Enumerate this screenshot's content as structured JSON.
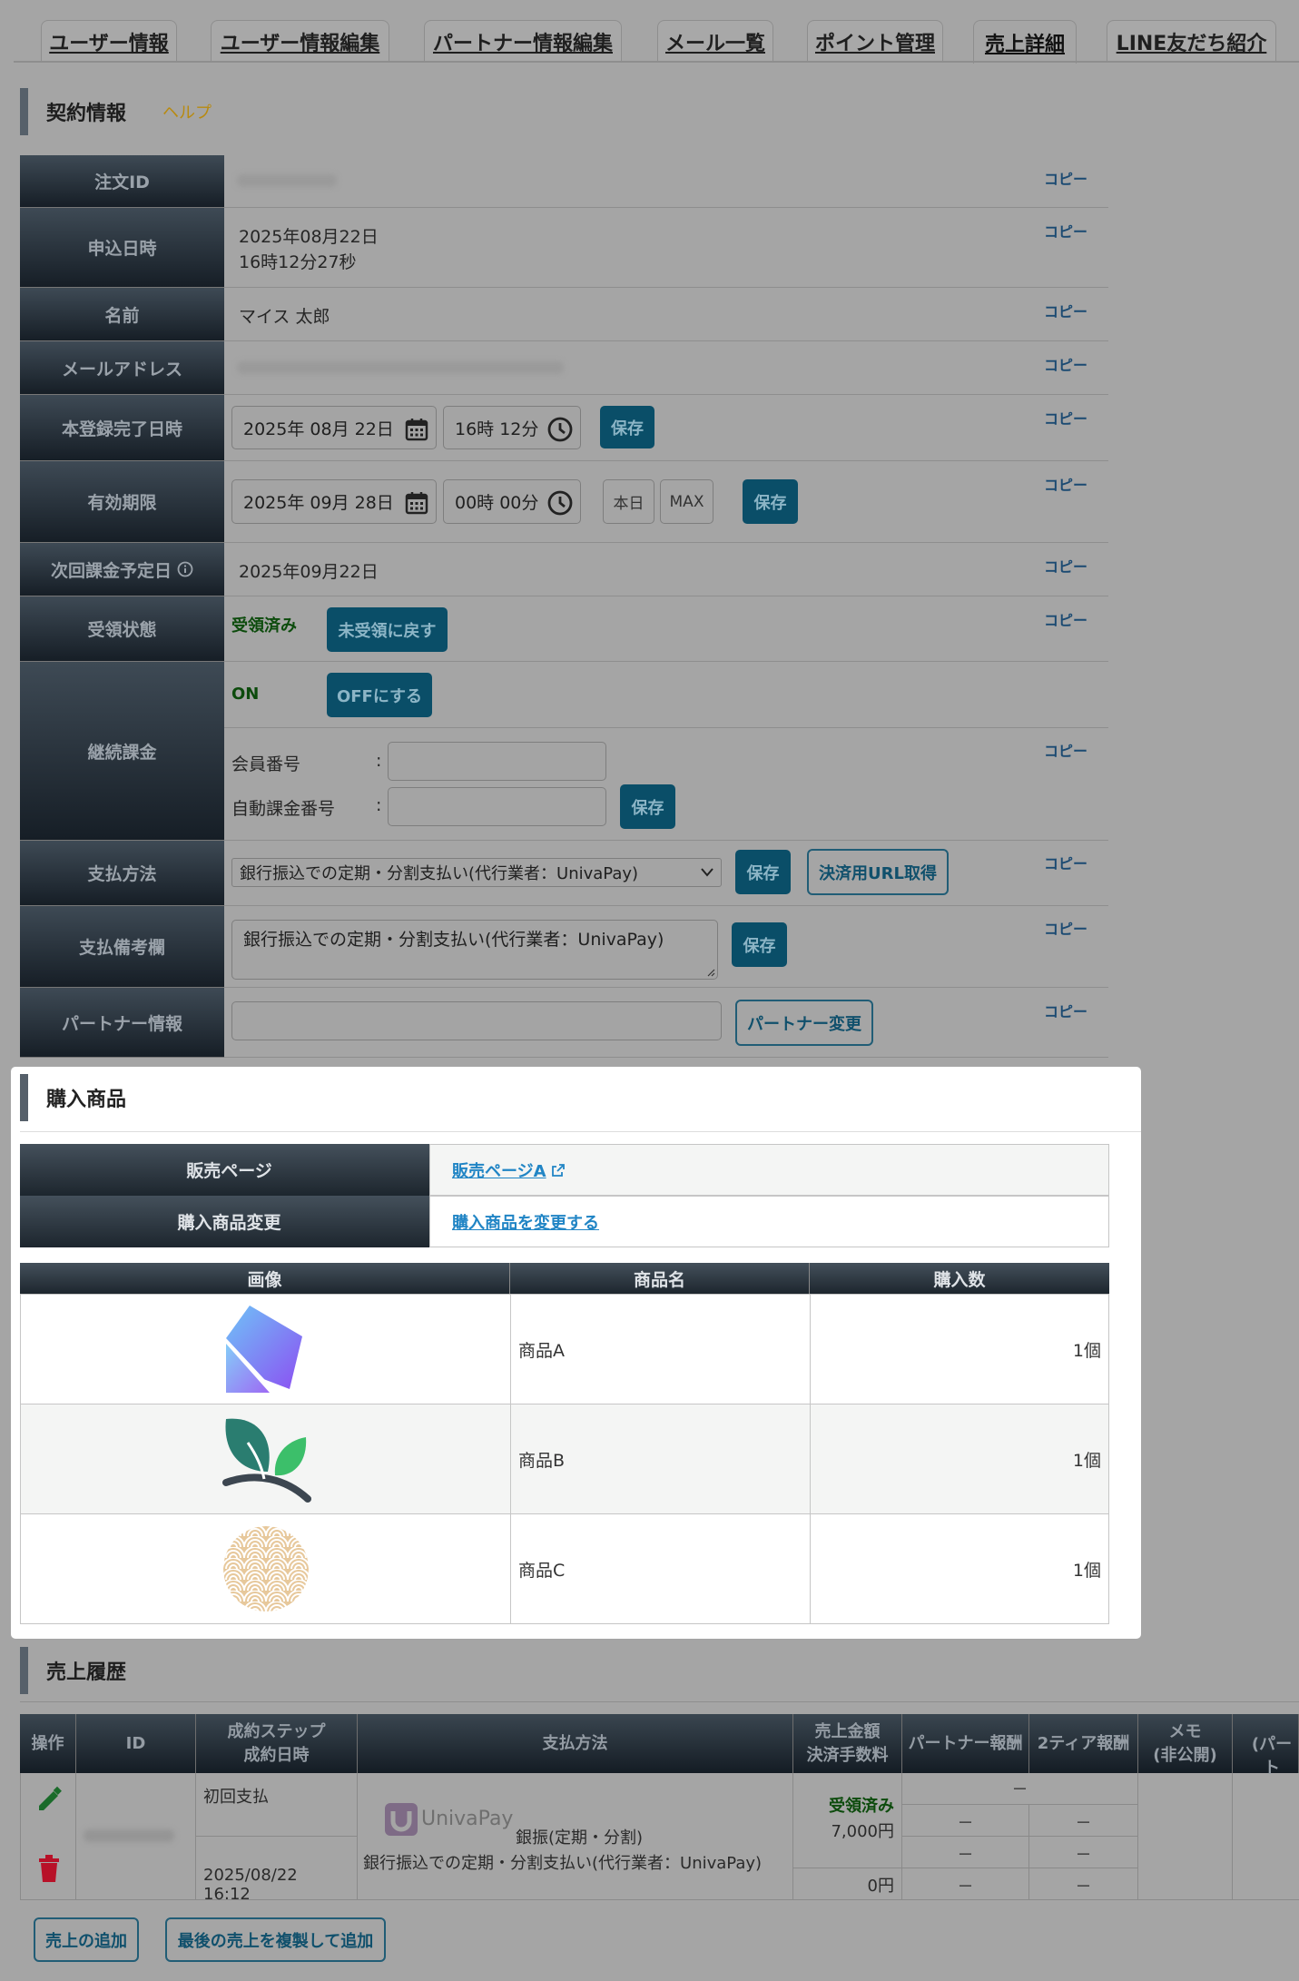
{
  "tabs": [
    {
      "label": "ユーザー情報"
    },
    {
      "label": "ユーザー情報編集"
    },
    {
      "label": "パートナー情報編集"
    },
    {
      "label": "メール一覧"
    },
    {
      "label": "ポイント管理"
    },
    {
      "label": "売上詳細"
    },
    {
      "label": "LINE友だち紹介"
    }
  ],
  "contract": {
    "title": "契約情報",
    "help": "ヘルプ",
    "copy": "コピー",
    "rows": {
      "order_id": {
        "label": "注文ID",
        "value": ""
      },
      "applied_at": {
        "label": "申込日時",
        "date": "2025年08月22日",
        "time": "16時12分27秒"
      },
      "name": {
        "label": "名前",
        "value": "マイス 太郎"
      },
      "email": {
        "label": "メールアドレス",
        "value": ""
      },
      "registered": {
        "label": "本登録完了日時",
        "date": "2025年 08月 22日",
        "time": "16時 12分",
        "save": "保存"
      },
      "expiry": {
        "label": "有効期限",
        "date": "2025年 09月 28日",
        "time": "00時 00分",
        "today": "本日",
        "max": "MAX",
        "save": "保存"
      },
      "next_billing": {
        "label": "次回課金予定日",
        "value": "2025年09月22日"
      },
      "receipt": {
        "label": "受領状態",
        "status": "受領済み",
        "button": "未受領に戻す"
      },
      "continuous": {
        "label": "継続課金",
        "status": "ON",
        "button": "OFFにする",
        "member_label": "会員番号",
        "auto_label": "自動課金番号",
        "colon": ":",
        "save": "保存"
      },
      "payment": {
        "label": "支払方法",
        "selected": "銀行振込での定期・分割支払い(代行業者：UnivaPay)",
        "save": "保存",
        "url_button": "決済用URL取得"
      },
      "payment_note": {
        "label": "支払備考欄",
        "value": "銀行振込での定期・分割支払い(代行業者：UnivaPay)",
        "save": "保存"
      },
      "partner": {
        "label": "パートナー情報",
        "value": "",
        "button": "パートナー変更"
      }
    }
  },
  "purchase": {
    "title": "購入商品",
    "sales_page_label": "販売ページ",
    "sales_page_link": "販売ページA",
    "change_label": "購入商品変更",
    "change_link": "購入商品を変更する",
    "headers": {
      "image": "画像",
      "name": "商品名",
      "qty": "購入数"
    },
    "items": [
      {
        "name": "商品A",
        "qty": "1個",
        "icon": "purple-gem-icon"
      },
      {
        "name": "商品B",
        "qty": "1個",
        "icon": "green-leaf-icon"
      },
      {
        "name": "商品C",
        "qty": "1個",
        "icon": "wave-pattern-icon"
      }
    ]
  },
  "history": {
    "title": "売上履歴",
    "headers": {
      "op": "操作",
      "id": "ID",
      "step1": "成約ステップ",
      "step2": "成約日時",
      "method": "支払方法",
      "amount1": "売上金額",
      "amount2": "決済手数料",
      "partner": "パートナー報酬",
      "tier2": "2ティア報酬",
      "memo1": "メモ",
      "memo2": "(非公開)",
      "last": "(パート"
    },
    "row": {
      "step": "初回支払",
      "datetime": "2025/08/22 16:12",
      "provider": "UnivaPay",
      "method1": "銀振(定期・分割)",
      "method2": "銀行振込での定期・分割支払い(代行業者：UnivaPay)",
      "status": "受領済み",
      "amount": "7,000円",
      "fee": "0円",
      "dash": "－"
    },
    "add_button": "売上の追加",
    "copy_button": "最後の売上を複製して追加"
  },
  "colors": {
    "accent": "#0a4e68",
    "green": "#0c4b0c",
    "link": "#2185c5"
  }
}
